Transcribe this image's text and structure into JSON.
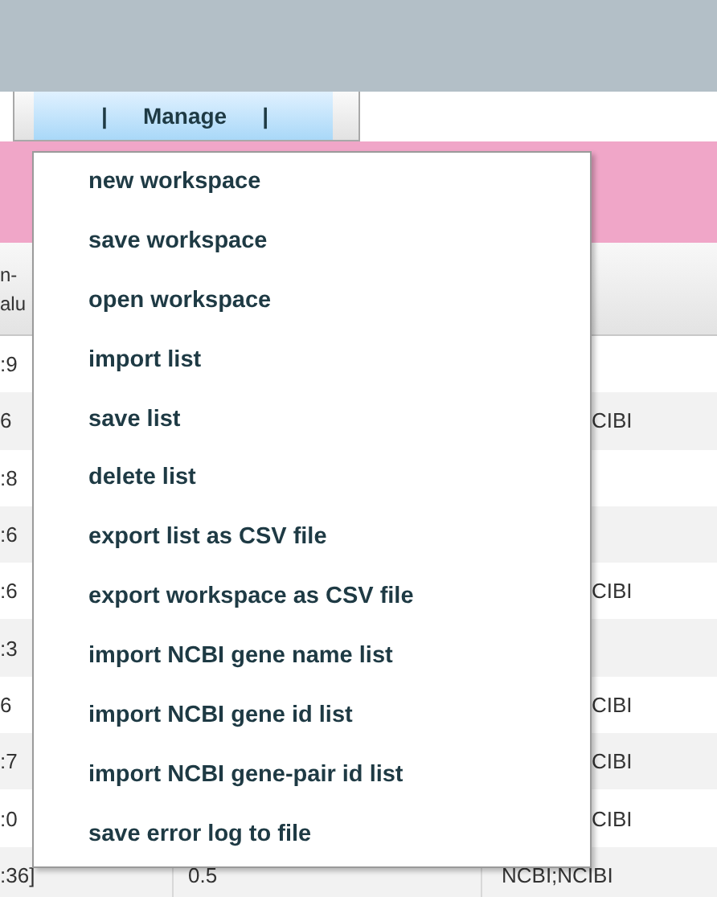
{
  "menu_bar": {
    "left_separator": "|",
    "right_separator": "|",
    "menu": {
      "label": "Manage",
      "selected": true
    }
  },
  "table": {
    "header": {
      "column_1": [
        "n-",
        "alu"
      ]
    },
    "rows": [
      {
        "column_1": ":9"
      },
      {
        "column_1": "6",
        "column_3": "CIBI"
      },
      {
        "column_1": ":8"
      },
      {
        "column_1": ":6"
      },
      {
        "column_1": ":6",
        "column_3": "CIBI"
      },
      {
        "column_1": ":3"
      },
      {
        "column_1": "6",
        "column_3": "CIBI"
      },
      {
        "column_1": ":7",
        "column_3": "CIBI"
      },
      {
        "column_1": ":0",
        "column_3": "CIBI"
      },
      {
        "column_1": ":36]",
        "column_2": "0.5",
        "column_3": "NCBI;NCIBI"
      }
    ]
  },
  "dropdown_menu": {
    "items": [
      {
        "label": "new workspace"
      },
      {
        "label": "save workspace"
      },
      {
        "label": "open workspace"
      },
      {
        "label": "import list"
      },
      {
        "label": "save list"
      },
      {
        "label": "delete list"
      },
      {
        "label": "export list as CSV file"
      },
      {
        "label": "export workspace as CSV file"
      },
      {
        "label": "import NCBI gene name list"
      },
      {
        "label": "import NCBI gene id list"
      },
      {
        "label": "import NCBI gene-pair id list"
      },
      {
        "label": "save error log to file"
      }
    ]
  }
}
